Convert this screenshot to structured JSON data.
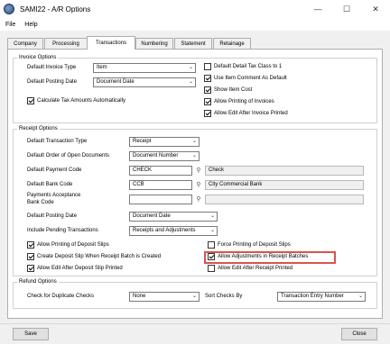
{
  "window": {
    "title": "SAMI22 - A/R Options"
  },
  "menu": {
    "file": "File",
    "help": "Help"
  },
  "tabs": [
    {
      "label": "Company"
    },
    {
      "label": "Processing"
    },
    {
      "label": "Transactions"
    },
    {
      "label": "Numbering"
    },
    {
      "label": "Statement"
    },
    {
      "label": "Retainage"
    }
  ],
  "active_tab": "Transactions",
  "invoice": {
    "group": "Invoice Options",
    "type_label": "Default Invoice Type",
    "type_value": "Item",
    "posting_label": "Default Posting Date",
    "posting_value": "Document Date",
    "calc_tax": "Calculate Tax Amounts Automatically",
    "default_tax_class": "Default Detail Tax Class to 1",
    "use_item_comment": "Use Item Comment As Default",
    "show_item_cost": "Show Item Cost",
    "allow_printing": "Allow Printing of Invoices",
    "allow_edit": "Allow Edit After Invoice Printed"
  },
  "receipt": {
    "group": "Receipt Options",
    "trans_type_label": "Default Transaction Type",
    "trans_type_value": "Receipt",
    "order_label": "Default Order of Open Documents",
    "order_value": "Document Number",
    "pay_code_label": "Default Payment Code",
    "pay_code_value": "CHECK",
    "pay_code_desc": "Check",
    "bank_label": "Default Bank Code",
    "bank_value": "CCB",
    "bank_desc": "City Commercial Bank",
    "payments_label_1": "Payments Acceptance",
    "payments_label_2": "Bank Code",
    "payments_value": "",
    "payments_desc": "",
    "posting_label": "Default Posting Date",
    "posting_value": "Document Date",
    "pending_label": "Include Pending Transactions",
    "pending_value": "Receipts and Adjustments",
    "allow_print_slips": "Allow Printing of Deposit Slips",
    "create_slip": "Create Deposit Slip When Receipt Batch is Created",
    "allow_edit_slip": "Allow Edit After Deposit Slip Printed",
    "force_print": "Force Printing of Deposit Slips",
    "allow_adjustments": "Allow Adjustments in Receipt Batches",
    "allow_edit_receipt": "Allow Edit After Receipt Printed"
  },
  "refund": {
    "group": "Refund Options",
    "duplicate_label": "Check for Duplicate Checks",
    "duplicate_value": "None",
    "sort_label": "Sort Checks By",
    "sort_value": "Transaction Entry Number"
  },
  "buttons": {
    "save": "Save",
    "close": "Close"
  }
}
